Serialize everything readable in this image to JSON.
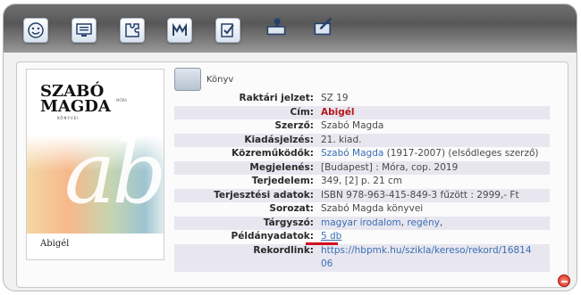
{
  "toolbar": {
    "buttons": [
      {
        "name": "smiley-icon"
      },
      {
        "name": "computer-icon"
      },
      {
        "name": "puzzle-icon"
      },
      {
        "name": "m-icon"
      },
      {
        "name": "checklist-icon"
      },
      {
        "name": "reader-icon"
      },
      {
        "name": "book-pen-icon"
      }
    ]
  },
  "cover": {
    "author_line1": "SZABÓ",
    "author_line2": "MAGDA",
    "subtitle": "KÖNYVEI",
    "publisher": "MÓRA",
    "title": "Abigél",
    "art_letters": "abig"
  },
  "record": {
    "type_label": "Könyv",
    "fields": [
      {
        "label": "Raktári jelzet:",
        "value": "SZ 19"
      },
      {
        "label": "Cím:",
        "value": "Abigél"
      },
      {
        "label": "Szerző:",
        "value": "Szabó Magda"
      },
      {
        "label": "Kiadásjelzés:",
        "value": "21. kiad."
      },
      {
        "label": "Közreműködők:",
        "link": "Szabó Magda",
        "value": " (1917-2007) (elsődleges szerző)"
      },
      {
        "label": "Megjelenés:",
        "value": "[Budapest] : Móra, cop. 2019"
      },
      {
        "label": "Terjedelem:",
        "value": "349, [2] p. 21 cm"
      },
      {
        "label": "Terjesztési adatok:",
        "value": "ISBN 978-963-415-849-3 fűzött : 2999,- Ft"
      },
      {
        "label": "Sorozat:",
        "value": "Szabó Magda könyvei"
      },
      {
        "label": "Tárgyszó:",
        "tag1": "magyar irodalom",
        "sep": ",",
        "tag2": "regény",
        "end": ","
      },
      {
        "label": "Példányadatok:",
        "value": "5 db"
      },
      {
        "label": "Rekordlink:",
        "value": "https://hbpmk.hu/szikla/kereso/rekord/16814",
        "value2": "06"
      }
    ]
  },
  "colors": {
    "title_red": "#b8161d",
    "link_blue": "#3a6fb3",
    "underline_red": "#d10f23"
  }
}
